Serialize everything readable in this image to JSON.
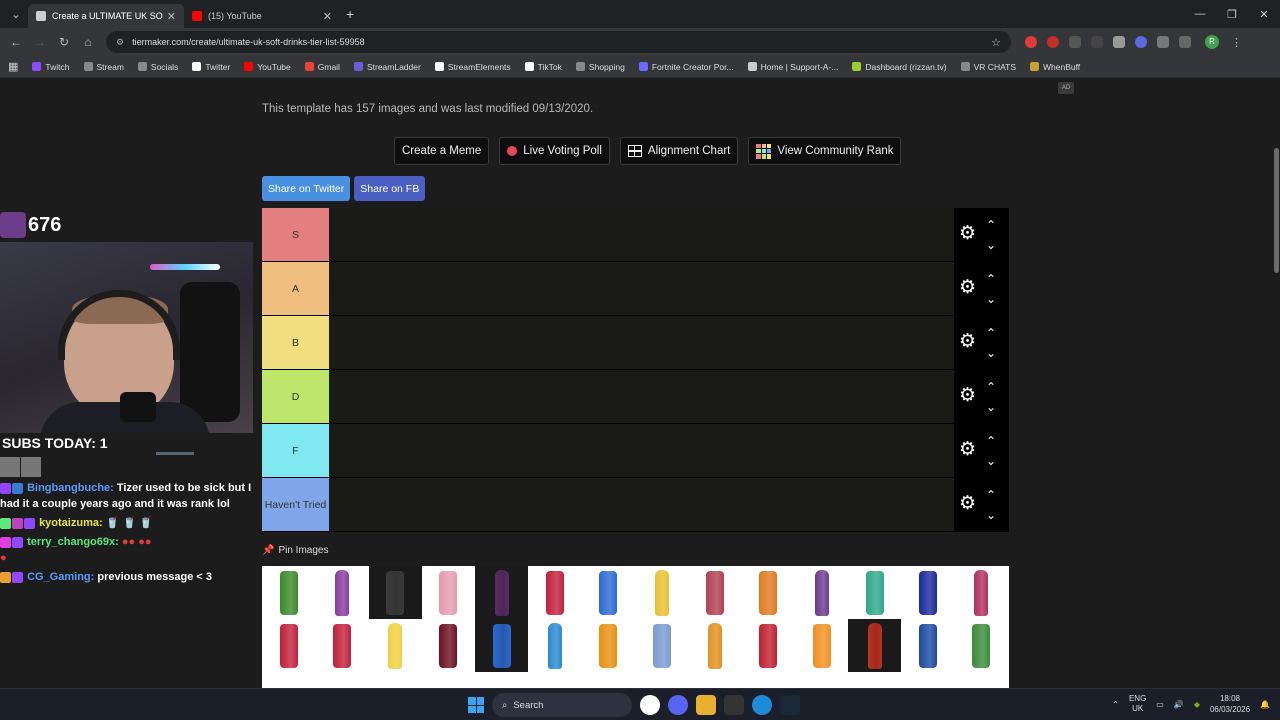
{
  "browser": {
    "tabs": [
      {
        "title": "Create a ULTIMATE UK SOFT DR",
        "active": true,
        "favicon_color": "#d0d0d0"
      },
      {
        "title": "(15) YouTube",
        "active": false,
        "favicon_color": "#ff0000"
      }
    ],
    "url": "tiermaker.com/create/ultimate-uk-soft-drinks-tier-list-59958",
    "bookmarks": [
      {
        "label": "Twitch",
        "color": "#9146ff"
      },
      {
        "label": "Stream",
        "color": "#888888"
      },
      {
        "label": "Socials",
        "color": "#888888"
      },
      {
        "label": "Twitter",
        "color": "#ffffff"
      },
      {
        "label": "YouTube",
        "color": "#ff0000"
      },
      {
        "label": "Gmail",
        "color": "#ea4335"
      },
      {
        "label": "StreamLadder",
        "color": "#6b5bd6"
      },
      {
        "label": "StreamElements",
        "color": "#ffffff"
      },
      {
        "label": "TikTok",
        "color": "#ffffff"
      },
      {
        "label": "Shopping",
        "color": "#888888"
      },
      {
        "label": "Fortnite Creator Por...",
        "color": "#6a6aff"
      },
      {
        "label": "Home | Support-A-...",
        "color": "#cccccc"
      },
      {
        "label": "Dashboard (rizzan.tv)",
        "color": "#9acd32"
      },
      {
        "label": "VR CHATS",
        "color": "#888888"
      },
      {
        "label": "WhenBuff",
        "color": "#c8a030"
      }
    ]
  },
  "page": {
    "ad_label": "AD",
    "info_text": "This template has 157 images and was last modified 09/13/2020.",
    "actions": {
      "create_meme": "Create a Meme",
      "live_voting": "Live Voting Poll",
      "alignment_chart": "Alignment Chart",
      "community_rank": "View Community Rank"
    },
    "share": {
      "twitter": "Share on Twitter",
      "facebook": "Share on FB",
      "twitter_color": "#4a90e2",
      "facebook_color": "#4a5fc1"
    },
    "tiers": [
      {
        "label": "S",
        "color": "#e37f7f"
      },
      {
        "label": "A",
        "color": "#f0bf7f"
      },
      {
        "label": "B",
        "color": "#f0de7f"
      },
      {
        "label": "D",
        "color": "#bde76b"
      },
      {
        "label": "F",
        "color": "#7fe8f0"
      },
      {
        "label": "Haven't Tried",
        "color": "#7fa6e8"
      }
    ],
    "pin_label": "Pin Images",
    "drink_colors": [
      "#3a8a2a",
      "#8a3aa0",
      "#3b3b3b",
      "#e59ab0",
      "#5a2a6a",
      "#c0203a",
      "#2a6ad0",
      "#e8c030",
      "#b04050",
      "#e07a20",
      "#6a3a90",
      "#2ea88a",
      "#1a2a9a",
      "#b03060",
      "#c0203a",
      "#c0203a",
      "#f0d040",
      "#6a1020",
      "#2a6ad0",
      "#2a8ad0",
      "#e89010",
      "#7a9ad0",
      "#e09020",
      "#c02030",
      "#f09020",
      "#c03020",
      "#1a4aa0",
      "#3a8a3a"
    ]
  },
  "stream": {
    "follower_count": "676",
    "subs_today": "SUBS TODAY: 1",
    "chat": [
      {
        "user": "Bingbangbuche:",
        "user_color": "#5b9bff",
        "message": "Tizer used to be sick but I had it a couple years ago and it was rank lol"
      },
      {
        "user": "kyotaizuma:",
        "user_color": "#e6e64a",
        "message": ""
      },
      {
        "user": "terry_chango69x:",
        "user_color": "#5ee87a",
        "message": ""
      },
      {
        "user": "CG_Gaming:",
        "user_color": "#5b9bff",
        "message": "previous message < 3"
      }
    ]
  },
  "taskbar": {
    "search_placeholder": "Search",
    "lang_top": "ENG",
    "lang_bottom": "UK",
    "time": "18:08",
    "date": "06/03/2026"
  }
}
